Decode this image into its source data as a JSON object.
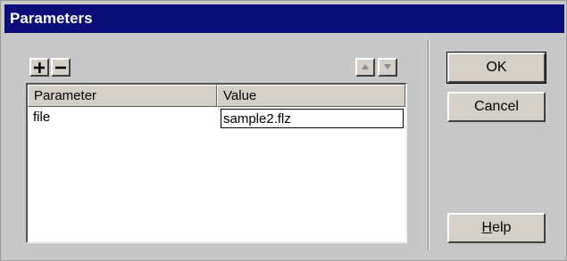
{
  "window": {
    "title": "Parameters"
  },
  "toolbar": {
    "add_icon": "plus-icon",
    "remove_icon": "minus-icon",
    "up_icon": "arrow-up-icon",
    "down_icon": "arrow-down-icon"
  },
  "table": {
    "columns": [
      "Parameter",
      "Value"
    ],
    "rows": [
      {
        "parameter": "file",
        "value": "sample2.flz"
      }
    ]
  },
  "buttons": {
    "ok": "OK",
    "cancel": "Cancel",
    "help_mnemonic": "H",
    "help_rest": "elp"
  }
}
